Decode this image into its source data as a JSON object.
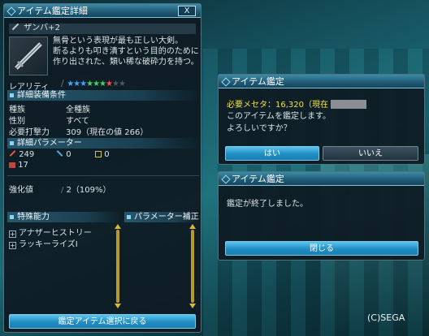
{
  "main_panel": {
    "title": "アイテム鑑定詳細",
    "close_label": "X",
    "item_name": "ザンバ+2",
    "description": [
      "無骨という表現が最も正しい大剣。",
      "断るよりも叩き潰すという目的のために",
      "作り出された、類い稀な破砕力を持つ。"
    ],
    "rarity_label": "レアリティ",
    "rarity_stars": 7,
    "rarity_max": 13,
    "conditions_header": "詳細装備条件",
    "conditions": [
      {
        "label": "種族",
        "value": "全種族"
      },
      {
        "label": "性別",
        "value": "すべて"
      },
      {
        "label": "必要打撃力",
        "value": "309（現在の値 266）"
      }
    ],
    "params_header": "詳細パラメーター",
    "params": [
      {
        "icon": "strike-icon",
        "value": "249"
      },
      {
        "icon": "range-icon",
        "value": "0"
      },
      {
        "icon": "tech-icon",
        "value": "0"
      },
      {
        "icon": "defense-icon",
        "value": "17"
      }
    ],
    "grind_label": "強化値",
    "grind_value": "2（109%）",
    "special_header": "特殊能力",
    "abilities": [
      "アナザーヒストリー",
      "ラッキーライズⅠ"
    ],
    "param_fix_header": "パラメーター補正",
    "back_button": "鑑定アイテム選択に戻る"
  },
  "confirm_dialog": {
    "title": "アイテム鑑定",
    "cost_line": "必要メセタ：16,320（現在",
    "line1": "このアイテムを鑑定します。",
    "line2": "よろしいですか？",
    "yes": "はい",
    "no": "いいえ"
  },
  "done_dialog": {
    "title": "アイテム鑑定",
    "message": "鑑定が終了しました。",
    "close": "閉じる"
  },
  "copyright": "(C)SEGA",
  "colors": {
    "accent": "#4fb8e8",
    "cost": "#f2e24a",
    "star_blue": "#3fa6ff",
    "star_green": "#42d36a",
    "star_red": "#ff4a4a"
  }
}
